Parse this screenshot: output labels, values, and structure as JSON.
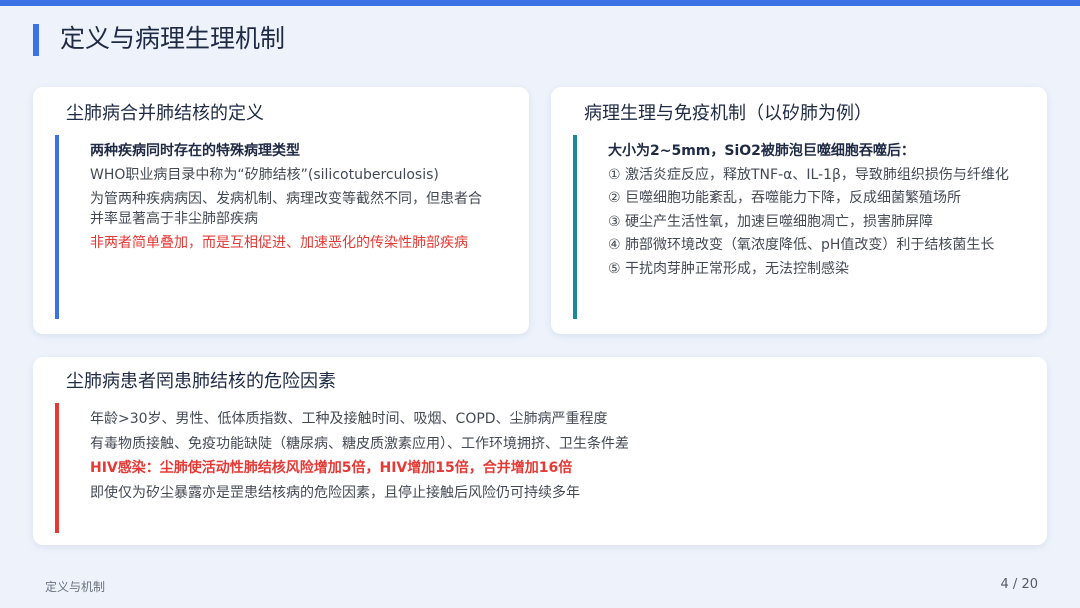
{
  "header": {
    "title": "定义与病理生理机制"
  },
  "card1": {
    "title": "尘肺病合并肺结核的定义",
    "lines": [
      {
        "text": "两种疾病同时存在的特殊病理类型",
        "style": "bold"
      },
      {
        "text": "WHO职业病目录中称为“矽肺结核”(silicotuberculosis)",
        "style": "normal"
      },
      {
        "text": "为管两种疾病病因、发病机制、病理改变等截然不同，但患者合",
        "style": "normal"
      },
      {
        "text": "并率显著高于非尘肺部疾病",
        "style": "normal"
      },
      {
        "text": "非两者简单叠加，而是互相促进、加速恶化的传染性肺部疾病",
        "style": "red"
      }
    ],
    "accent_color": "#3b73e6"
  },
  "card2": {
    "title": "病理生理与免疫机制（以矽肺为例）",
    "lines": [
      {
        "text": "大小为2~5mm，SiO2被肺泡巨噬细胞吞噬后：",
        "style": "bold"
      },
      {
        "text": "① 激活炎症反应，释放TNF-α、IL-1β，导致肺组织损伤与纤维化",
        "style": "normal"
      },
      {
        "text": "② 巨噬细胞功能紊乱，吞噬能力下降，反成细菌繁殖场所",
        "style": "normal"
      },
      {
        "text": "③ 硬尘产生活性氧，加速巨噬细胞凋亡，损害肺屏障",
        "style": "normal"
      },
      {
        "text": "④ 肺部微环境改变（氧浓度降低、pH值改变）利于结核菌生长",
        "style": "normal"
      },
      {
        "text": "⑤ 干扰肉芽肿正常形成，无法控制感染",
        "style": "normal"
      }
    ],
    "accent_color": "#1a8a9a"
  },
  "card3": {
    "title": "尘肺病患者罔患肺结核的危险因素",
    "lines": [
      {
        "text": "年龄>30岁、男性、低体质指数、工种及接触时间、吸烟、COPD、尘肺病严重程度",
        "style": "normal"
      },
      {
        "text": "有毒物质接触、免疫功能缺陡（糖尿病、糖皮质激素应用）、工作环境拥挤、卫生条件差",
        "style": "normal"
      },
      {
        "text": "HIV感染：尘肺使活动性肺结核风险增加5倍，HIV增加15倍，合并增加16倍",
        "style": "bold-red"
      },
      {
        "text": "即使仅为矽尘暴露亦是罡患结核病的危险因素，且停止接触后风险仍可持续多年",
        "style": "normal"
      }
    ],
    "accent_color": "#e53935"
  },
  "footer": {
    "section": "定义与机制",
    "page": "4 / 20"
  }
}
